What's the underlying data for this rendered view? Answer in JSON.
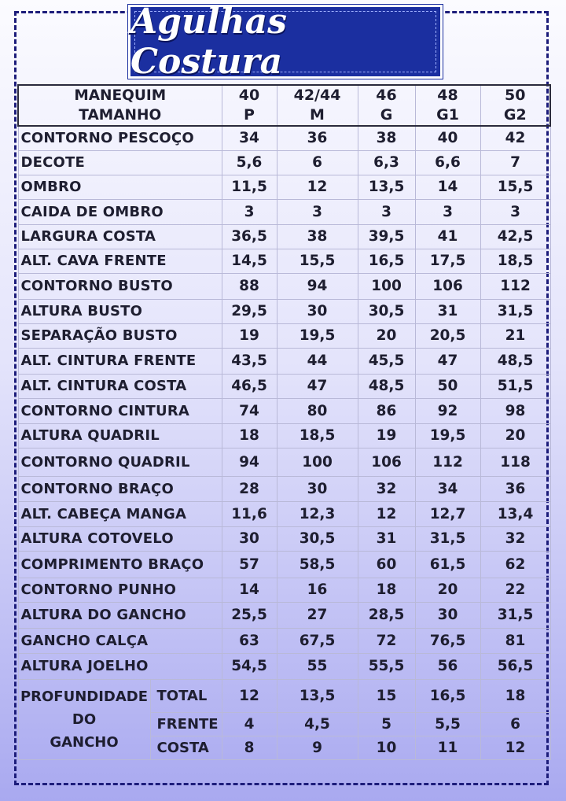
{
  "logo": {
    "text": "Agulhas Costura"
  },
  "header": {
    "label_line1": "MANEQUIM",
    "label_line2": "TAMANHO",
    "sizes": [
      {
        "num": "40",
        "letter": "P"
      },
      {
        "num": "42/44",
        "letter": "M"
      },
      {
        "num": "46",
        "letter": "G"
      },
      {
        "num": "48",
        "letter": "G1"
      },
      {
        "num": "50",
        "letter": "G2"
      }
    ]
  },
  "rows": [
    {
      "label": "CONTORNO PESCOÇO",
      "values": [
        "34",
        "36",
        "38",
        "40",
        "42"
      ]
    },
    {
      "label": "DECOTE",
      "values": [
        "5,6",
        "6",
        "6,3",
        "6,6",
        "7"
      ]
    },
    {
      "label": "OMBRO",
      "values": [
        "11,5",
        "12",
        "13,5",
        "14",
        "15,5"
      ]
    },
    {
      "label": "CAIDA DE OMBRO",
      "values": [
        "3",
        "3",
        "3",
        "3",
        "3"
      ]
    },
    {
      "label": "LARGURA COSTA",
      "values": [
        "36,5",
        "38",
        "39,5",
        "41",
        "42,5"
      ]
    },
    {
      "label": "ALT. CAVA FRENTE",
      "values": [
        "14,5",
        "15,5",
        "16,5",
        "17,5",
        "18,5"
      ]
    },
    {
      "label": "CONTORNO BUSTO",
      "values": [
        "88",
        "94",
        "100",
        "106",
        "112"
      ]
    },
    {
      "label": "ALTURA BUSTO",
      "values": [
        "29,5",
        "30",
        "30,5",
        "31",
        "31,5"
      ]
    },
    {
      "label": "SEPARAÇÃO BUSTO",
      "values": [
        "19",
        "19,5",
        "20",
        "20,5",
        "21"
      ]
    },
    {
      "label": "ALT. CINTURA FRENTE",
      "values": [
        "43,5",
        "44",
        "45,5",
        "47",
        "48,5"
      ]
    },
    {
      "label": "ALT. CINTURA COSTA",
      "values": [
        "46,5",
        "47",
        "48,5",
        "50",
        "51,5"
      ]
    },
    {
      "label": "CONTORNO CINTURA",
      "values": [
        "74",
        "80",
        "86",
        "92",
        "98"
      ]
    },
    {
      "label": "ALTURA QUADRIL",
      "values": [
        "18",
        "18,5",
        "19",
        "19,5",
        "20"
      ]
    },
    {
      "label": "CONTORNO QUADRIL",
      "values": [
        "94",
        "100",
        "106",
        "112",
        "118"
      ]
    },
    {
      "label": "CONTORNO BRAÇO",
      "values": [
        "28",
        "30",
        "32",
        "34",
        "36"
      ]
    },
    {
      "label": "ALT. CABEÇA MANGA",
      "values": [
        "11,6",
        "12,3",
        "12",
        "12,7",
        "13,4"
      ]
    },
    {
      "label": "ALTURA COTOVELO",
      "values": [
        "30",
        "30,5",
        "31",
        "31,5",
        "32"
      ]
    },
    {
      "label": "COMPRIMENTO BRAÇO",
      "values": [
        "57",
        "58,5",
        "60",
        "61,5",
        "62"
      ]
    },
    {
      "label": "CONTORNO PUNHO",
      "values": [
        "14",
        "16",
        "18",
        "20",
        "22"
      ]
    },
    {
      "label": "ALTURA DO GANCHO",
      "values": [
        "25,5",
        "27",
        "28,5",
        "30",
        "31,5"
      ]
    },
    {
      "label": "GANCHO CALÇA",
      "values": [
        "63",
        "67,5",
        "72",
        "76,5",
        "81"
      ]
    },
    {
      "label": "ALTURA JOELHO",
      "values": [
        "54,5",
        "55",
        "55,5",
        "56",
        "56,5"
      ]
    }
  ],
  "depth": {
    "label_lines": [
      "PROFUNDIDADE",
      "DO",
      "GANCHO"
    ],
    "rows": [
      {
        "sub": "TOTAL",
        "values": [
          "12",
          "13,5",
          "15",
          "16,5",
          "18"
        ]
      },
      {
        "sub": "FRENTE",
        "values": [
          "4",
          "4,5",
          "5",
          "5,5",
          "6"
        ]
      },
      {
        "sub": "COSTA",
        "values": [
          "8",
          "9",
          "10",
          "11",
          "12"
        ]
      }
    ]
  }
}
